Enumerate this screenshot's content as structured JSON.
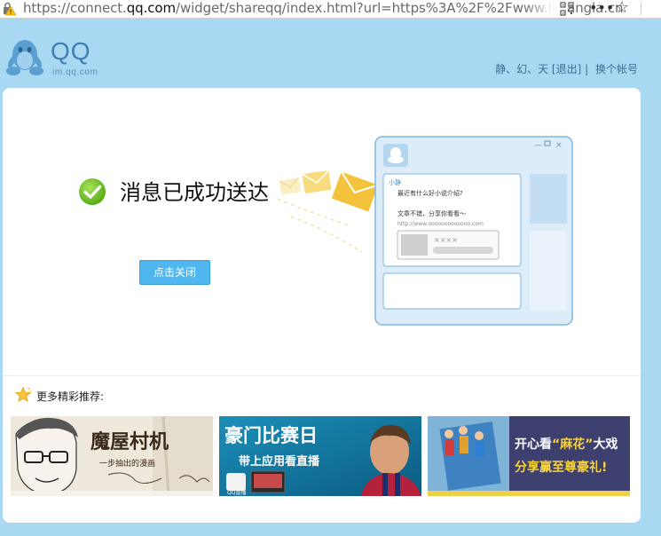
{
  "browser": {
    "url_prefix": "https://connect.",
    "url_domain": "qq.com",
    "url_suffix": "/widget/shareqq/index.html?url=https%3A%2F%2Fwww.liulangla.cn",
    "more_label": "•••",
    "bookmark_icon": "star-outline-icon"
  },
  "header": {
    "logo_text": "QQ",
    "domain_text": "im.qq.com",
    "username": "静、幻、天",
    "logout_label": "[退出]",
    "separator": "|",
    "switch_account_label": "换个帐号"
  },
  "main": {
    "success_message": "消息已成功送达",
    "close_button_label": "点击关闭",
    "illustration": {
      "sender_name": "小静",
      "message_line": "最近有什么好小说介绍?",
      "share_title": "文章不错，分享你看看～",
      "share_url": "http://www.ooooooooooooo.com",
      "share_placeholder": "××××"
    }
  },
  "recommend": {
    "label": "更多精彩推荐:",
    "banners": [
      {
        "title": "魔屋村机",
        "subtitle": "一步抽出的漫画"
      },
      {
        "title": "豪门比赛日",
        "subtitle": "带上应用看直播",
        "badge": "QQ直播"
      },
      {
        "title_prefix": "开心看",
        "title_highlight": "“麻花”",
        "title_suffix": "大戏",
        "subtitle": "分享赢至尊豪礼!"
      }
    ]
  },
  "colors": {
    "page_bg": "#a9d8f3",
    "accent": "#4fb6ee",
    "success_green": "#6cc21b",
    "logo_blue": "#3f7fb3"
  }
}
